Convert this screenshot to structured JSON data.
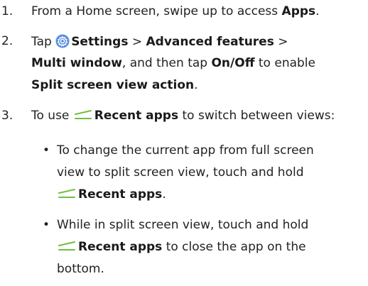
{
  "steps": [
    {
      "num": "1.",
      "l1_pre": "From a Home screen, swipe up to access ",
      "l1_bold": "Apps",
      "l1_post": "."
    },
    {
      "num": "2.",
      "tap": "Tap ",
      "settings": "Settings",
      "sep1": " > ",
      "advanced": "Advanced features",
      "sep2": " >",
      "multi": "Multi window",
      "l2_mid": ", and then tap ",
      "onoff": "On/Off",
      "l2_post": " to enable",
      "split_action": "Split screen view action",
      "l3_post": "."
    },
    {
      "num": "3.",
      "pre": "To use ",
      "recent": "Recent apps",
      "post": " to switch between views:"
    }
  ],
  "bullets": [
    {
      "symbol": "•",
      "line1": "To change the current app from full screen",
      "line2": "view to split screen view, touch and hold",
      "recent": "Recent apps",
      "end": "."
    },
    {
      "symbol": "•",
      "line1": "While in split screen view, touch and hold",
      "recent": "Recent apps",
      "line2_post": " to close the app on the",
      "line3": "bottom."
    }
  ],
  "icons": {
    "settings_icon": "gear-icon",
    "settings_color": "#5b8de0",
    "recent_icon": "recent-apps-icon",
    "recent_color": "#6fbf3f"
  }
}
